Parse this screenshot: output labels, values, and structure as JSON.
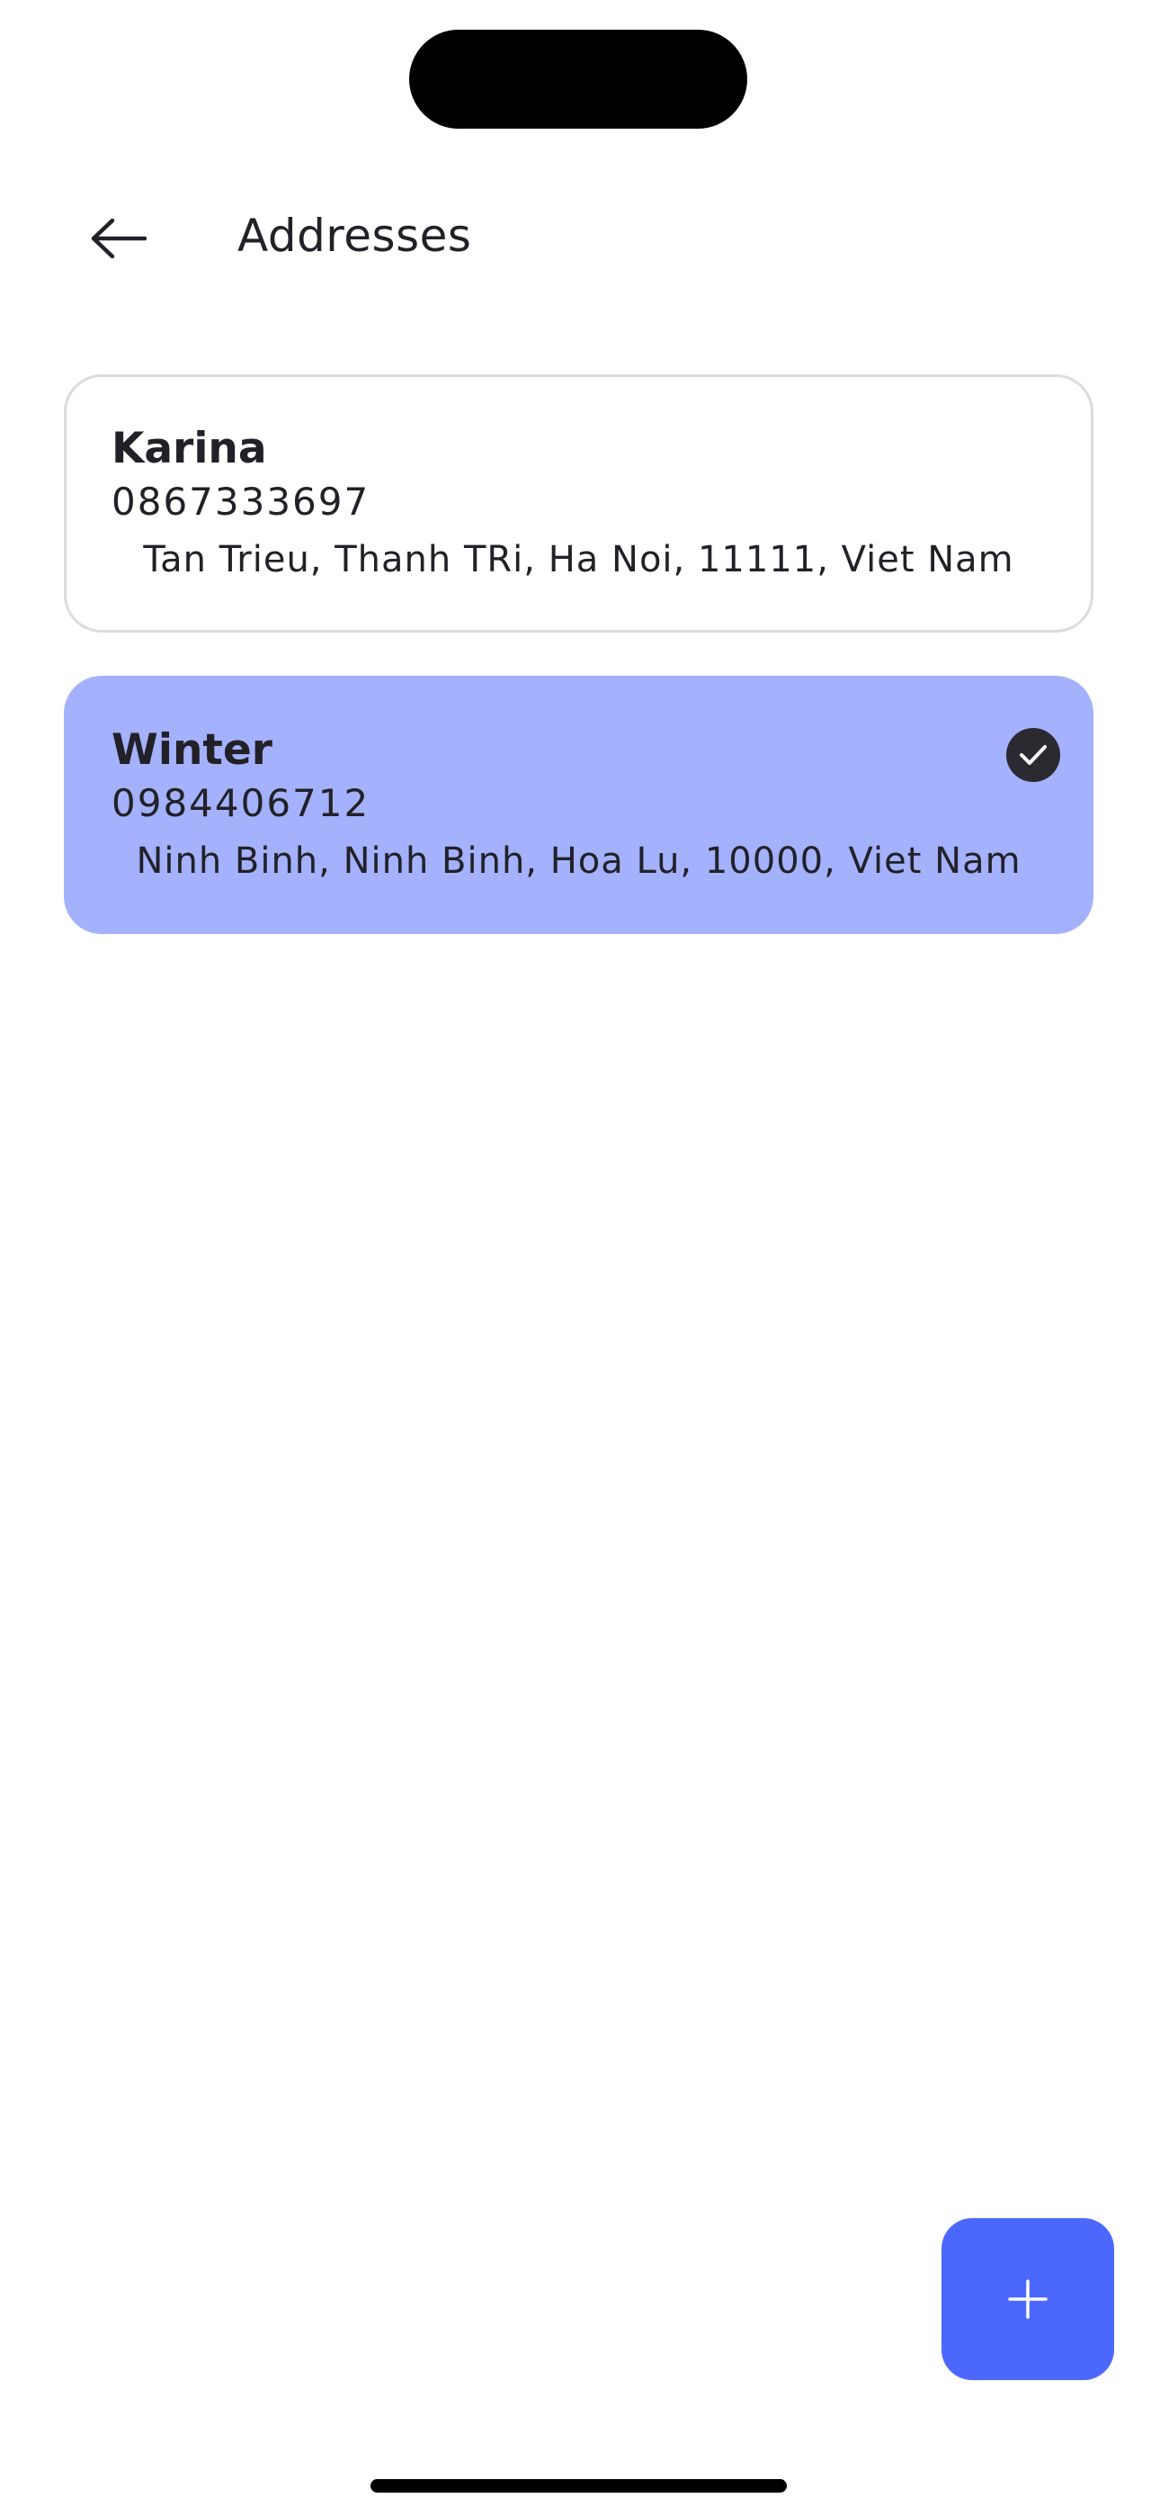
{
  "header": {
    "title": "Addresses",
    "back_icon": "arrow-left-icon"
  },
  "addresses": [
    {
      "name": "Karina",
      "phone": "0867333697",
      "address": "Tan Trieu, Thanh TRi, Ha Noi, 11111, Viet Nam",
      "selected": false
    },
    {
      "name": "Winter",
      "phone": "0984406712",
      "address": "Ninh Binh, Ninh Binh, Hoa Lu, 10000, Viet Nam",
      "selected": true,
      "selected_icon": "check-circle-icon"
    }
  ],
  "fab": {
    "icon": "plus-icon"
  },
  "colors": {
    "accent": "#4c68fc",
    "selected_card": "#a4b1fd",
    "text": "#222127",
    "card_border": "#dcdcdc"
  }
}
